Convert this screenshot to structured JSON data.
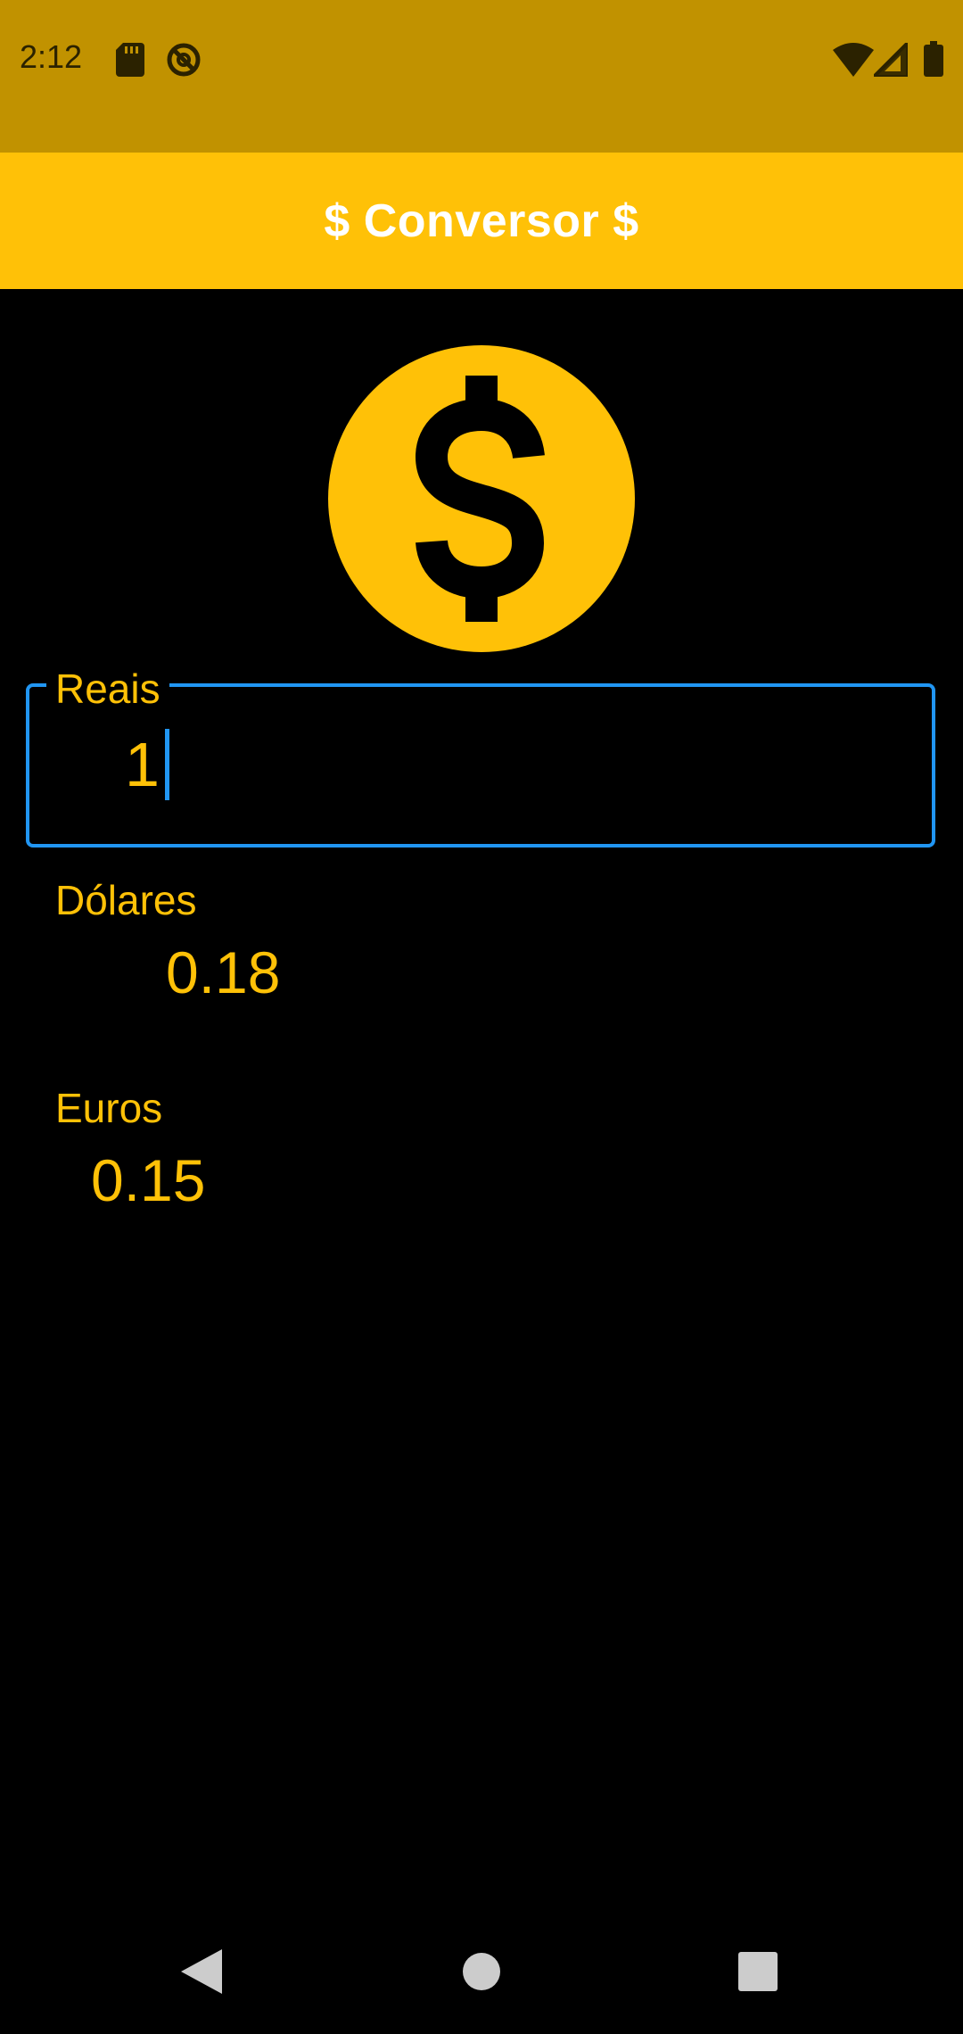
{
  "status_bar": {
    "time": "2:12",
    "icons_left": [
      "sd-card-icon",
      "no-disturb-icon"
    ],
    "icons_right": [
      "wifi-icon",
      "signal-icon",
      "battery-icon"
    ]
  },
  "app_bar": {
    "title": "$ Conversor $"
  },
  "hero_icon": "dollar-coin-icon",
  "form": {
    "reais": {
      "label": "Reais",
      "value": "1"
    },
    "dolares": {
      "label": "Dólares",
      "value": "0.18"
    },
    "euros": {
      "label": "Euros",
      "value": "0.15"
    }
  },
  "navigation": {
    "items": [
      "back-icon",
      "home-icon",
      "recents-icon"
    ]
  },
  "colors": {
    "status_bar": "#C19200",
    "primary": "#FFC107",
    "focus": "#2196F3",
    "background": "#000000"
  }
}
